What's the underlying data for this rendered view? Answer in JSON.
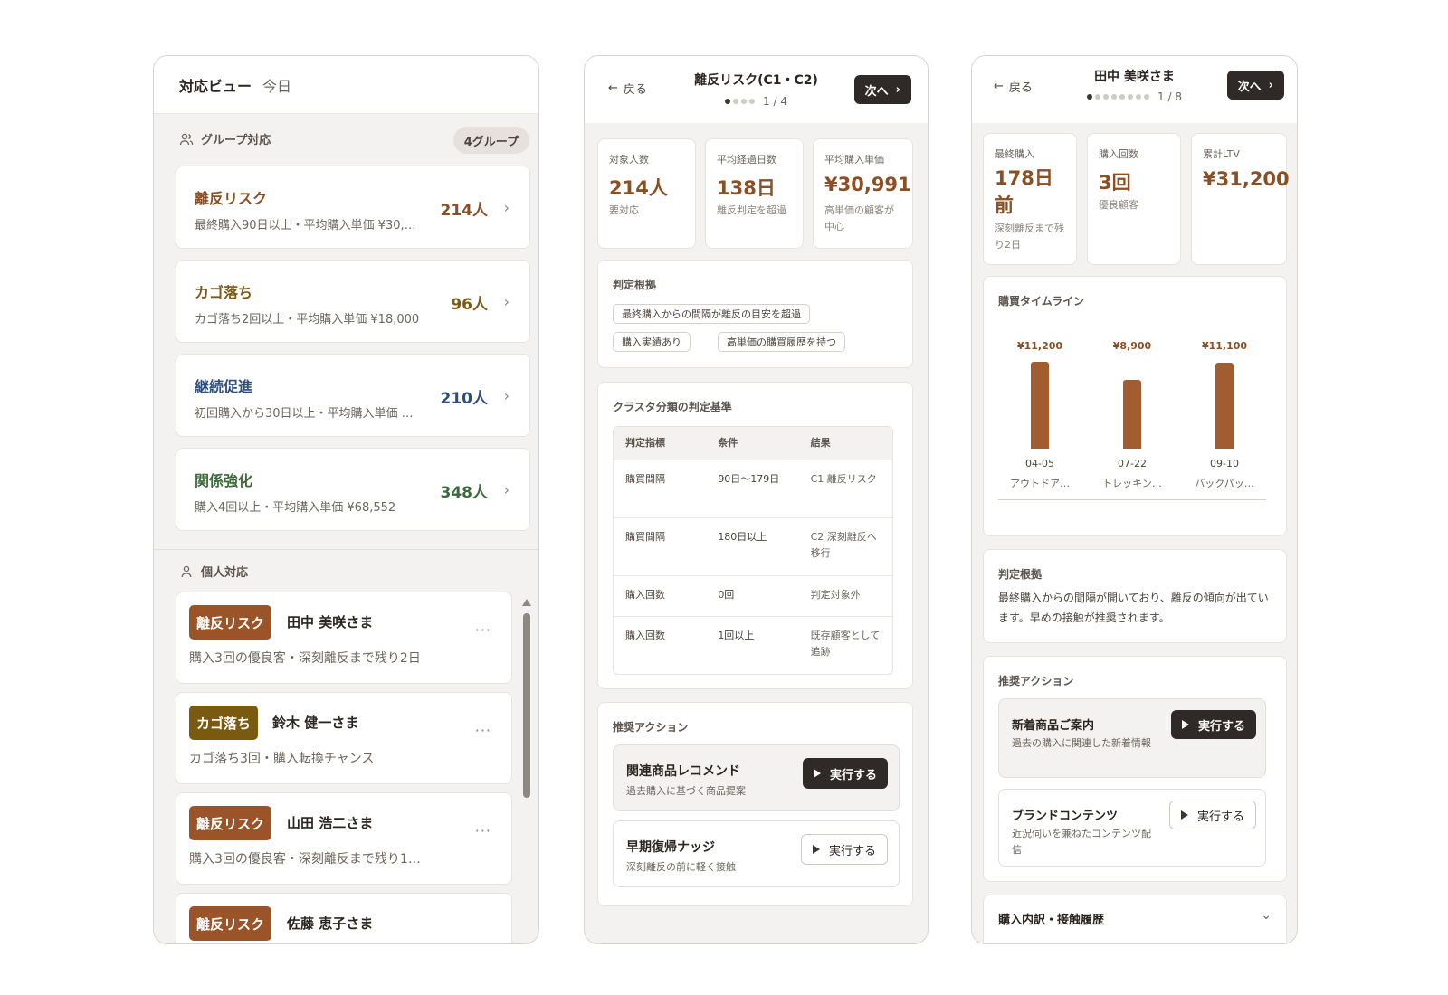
{
  "view1": {
    "title": "対応ビュー",
    "subtitle": "今日",
    "group_section": {
      "label": "グループ対応",
      "count": "4グループ"
    },
    "groups": [
      {
        "name": "離反リスク",
        "desc": "最終購入90日以上・平均購入単価 ¥30,…",
        "count": "214人",
        "color": "#8a4f25"
      },
      {
        "name": "カゴ落ち",
        "desc": "カゴ落ち2回以上・平均購入単価 ¥18,000",
        "count": "96人",
        "color": "#7a5a15"
      },
      {
        "name": "継続促進",
        "desc": "初回購入から30日以上・平均購入単価 …",
        "count": "210人",
        "color": "#2f4f7a"
      },
      {
        "name": "関係強化",
        "desc": "購入4回以上・平均購入単価 ¥68,552",
        "count": "348人",
        "color": "#3d6a3a"
      }
    ],
    "individual_section": {
      "label": "個人対応"
    },
    "individuals": [
      {
        "badge": "離反リスク",
        "badge_color": "#9a5428",
        "name": "田中 美咲さま",
        "desc": "購入3回の優良客・深刻離反まで残り2日"
      },
      {
        "badge": "カゴ落ち",
        "badge_color": "#7a5a10",
        "name": "鈴木 健一さま",
        "desc": "カゴ落ち3回・購入転換チャンス"
      },
      {
        "badge": "離反リスク",
        "badge_color": "#9a5428",
        "name": "山田 浩二さま",
        "desc": "購入3回の優良客・深刻離反まで残り1…"
      },
      {
        "badge": "離反リスク",
        "badge_color": "#9a5428",
        "name": "佐藤 恵子さま",
        "desc": ""
      }
    ]
  },
  "view2": {
    "back": "戻る",
    "title": "離反リスク(C1・C2)",
    "pager": "1 / 4",
    "next": "次へ",
    "stats": [
      {
        "label": "対象人数",
        "value": "214人",
        "sub": "要対応"
      },
      {
        "label": "平均経過日数",
        "value": "138日",
        "sub": "離反判定を超過"
      },
      {
        "label": "平均購入単価",
        "value": "¥30,991",
        "sub": "高単価の顧客が中心"
      }
    ],
    "basis": {
      "title": "判定根拠",
      "tags": [
        "最終購入からの間隔が離反の目安を超過",
        "購入実績あり",
        "高単価の購買履歴を持つ"
      ]
    },
    "criteria": {
      "title": "クラスタ分類の判定基準",
      "headers": [
        "判定指標",
        "条件",
        "結果"
      ],
      "rows": [
        [
          "購買間隔",
          "90日〜179日",
          "C1 離反リスク"
        ],
        [
          "購買間隔",
          "180日以上",
          "C2 深刻離反へ移行"
        ],
        [
          "購入回数",
          "0回",
          "判定対象外"
        ],
        [
          "購入回数",
          "1回以上",
          "既存顧客として追跡"
        ]
      ]
    },
    "actions": {
      "title": "推奨アクション",
      "items": [
        {
          "name": "関連商品レコメンド",
          "desc": "過去購入に基づく商品提案",
          "button": "実行する"
        },
        {
          "name": "早期復帰ナッジ",
          "desc": "深刻離反の前に軽く接触",
          "button": "実行する"
        }
      ]
    }
  },
  "view3": {
    "back": "戻る",
    "title": "田中 美咲さま",
    "pager": "1 / 8",
    "next": "次へ",
    "stats": [
      {
        "label": "最終購入",
        "value": "178日前",
        "sub": "深刻離反まで残り2日"
      },
      {
        "label": "購入回数",
        "value": "3回",
        "sub": "優良顧客"
      },
      {
        "label": "累計LTV",
        "value": "¥31,200",
        "sub": ""
      }
    ],
    "timeline_title": "購買タイムライン",
    "chart_data": {
      "type": "bar",
      "categories": [
        "04-05",
        "07-22",
        "09-10"
      ],
      "items": [
        "アウトドア…",
        "トレッキン…",
        "バックパッ…"
      ],
      "values": [
        11200,
        8900,
        11100
      ],
      "value_labels": [
        "¥11,200",
        "¥8,900",
        "¥11,100"
      ],
      "ylim": [
        0,
        11200
      ]
    },
    "basis": {
      "title": "判定根拠",
      "text": "最終購入からの間隔が開いており、離反の傾向が出ています。早めの接触が推奨されます。"
    },
    "actions": {
      "title": "推奨アクション",
      "items": [
        {
          "name": "新着商品ご案内",
          "desc": "過去の購入に関連した新着情報",
          "button": "実行する"
        },
        {
          "name": "ブランドコンテンツ",
          "desc": "近況伺いを兼ねたコンテンツ配信",
          "button": "実行する"
        }
      ]
    },
    "history_title": "購入内訳・接触履歴"
  }
}
